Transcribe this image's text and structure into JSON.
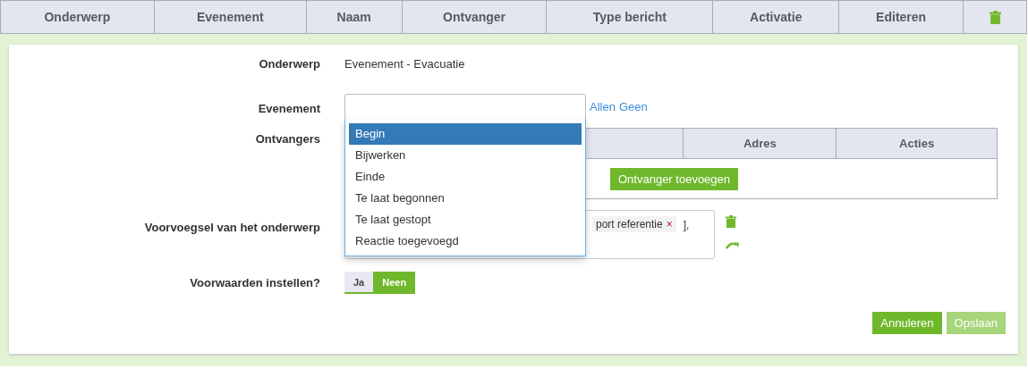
{
  "columns": [
    "Onderwerp",
    "Evenement",
    "Naam",
    "Ontvanger",
    "Type bericht",
    "Activatie",
    "Editeren"
  ],
  "form": {
    "subject": {
      "label": "Onderwerp",
      "value": "Evenement - Evacuatie"
    },
    "event": {
      "label": "Evenement",
      "links": [
        "Allen",
        "Geen"
      ],
      "options": [
        {
          "label": "Begin",
          "selected": true
        },
        {
          "label": "Bijwerken",
          "selected": false
        },
        {
          "label": "Einde",
          "selected": false
        },
        {
          "label": "Te laat begonnen",
          "selected": false
        },
        {
          "label": "Te laat gestopt",
          "selected": false
        },
        {
          "label": "Reactie toegevoegd",
          "selected": false
        }
      ]
    },
    "recipients": {
      "label": "Ontvangers",
      "columns": [
        "Adres",
        "Acties"
      ],
      "add_button": "Ontvanger toevoegen"
    },
    "prefix": {
      "label": "Voorvoegsel van het onderwerp",
      "tags": [
        {
          "text": "port referentie",
          "remove": "×"
        }
      ],
      "trailing": "],"
    },
    "conditions": {
      "label": "Voorwaarden instellen?",
      "options": [
        {
          "label": "Ja",
          "selected": false
        },
        {
          "label": "Neen",
          "selected": true
        }
      ]
    }
  },
  "buttons": [
    {
      "label": "Annuleren",
      "disabled": false
    },
    {
      "label": "Opslaan",
      "disabled": true
    }
  ]
}
